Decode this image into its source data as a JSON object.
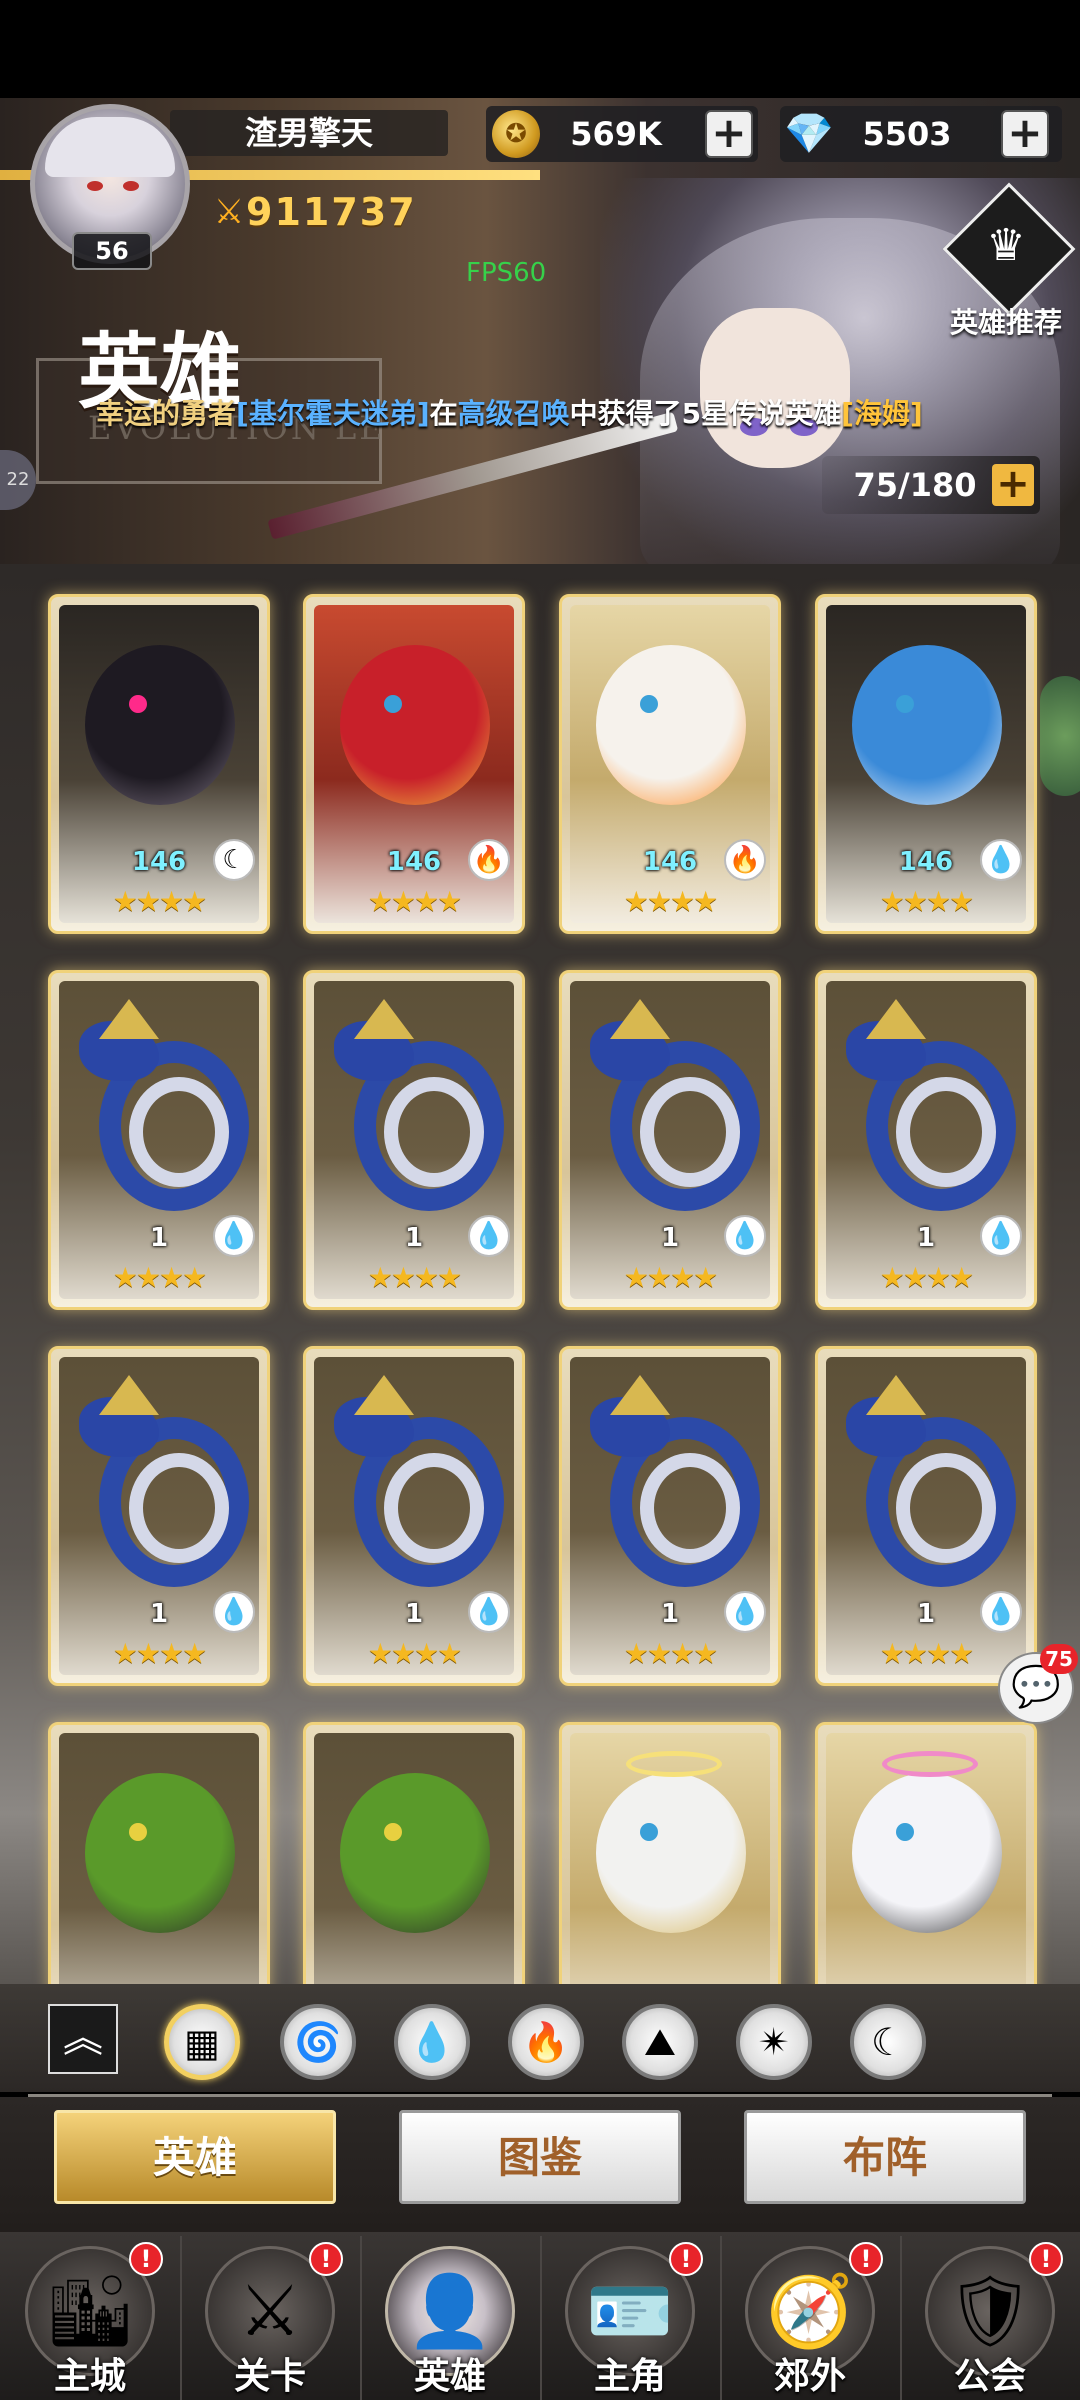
{
  "player": {
    "name": "渣男擎天",
    "level": "56",
    "power": "911737"
  },
  "currency": {
    "gold": "569K",
    "gems": "5503",
    "plus": "+"
  },
  "fps": "FPS60",
  "recommend_label": "英雄推荐",
  "page_title": "英雄",
  "title_watermark": "EVOLUTION LE",
  "side_bubble": "22",
  "marquee": {
    "part1": "幸运的勇者",
    "part2": "[基尔霍夫迷弟]",
    "part3": "在",
    "part4": "高级召唤",
    "part5": "中获得了5星传说英雄",
    "part6": "[海姆]"
  },
  "capacity": {
    "value": "75/180",
    "plus": "+"
  },
  "hero_cards": [
    {
      "level": "146",
      "element": "moon-icon",
      "stars": 4
    },
    {
      "level": "146",
      "element": "fire-icon",
      "stars": 4
    },
    {
      "level": "146",
      "element": "fire-icon",
      "stars": 4
    },
    {
      "level": "146",
      "element": "water-icon",
      "stars": 4
    },
    {
      "level": "1",
      "element": "water-icon",
      "stars": 4
    },
    {
      "level": "1",
      "element": "water-icon",
      "stars": 4
    },
    {
      "level": "1",
      "element": "water-icon",
      "stars": 4
    },
    {
      "level": "1",
      "element": "water-icon",
      "stars": 4
    },
    {
      "level": "1",
      "element": "water-icon",
      "stars": 4
    },
    {
      "level": "1",
      "element": "water-icon",
      "stars": 4
    },
    {
      "level": "1",
      "element": "water-icon",
      "stars": 4
    },
    {
      "level": "1",
      "element": "water-icon",
      "stars": 4
    },
    {
      "level": "",
      "element": "wind-icon",
      "stars": 0
    },
    {
      "level": "",
      "element": "wind-icon",
      "stars": 0
    },
    {
      "level": "",
      "element": "light-icon",
      "stars": 0
    },
    {
      "level": "",
      "element": "light-icon",
      "stars": 0
    }
  ],
  "filters": [
    {
      "name": "all-filter-icon",
      "glyph": "▦",
      "active": true
    },
    {
      "name": "wind-filter-icon",
      "glyph": "🌀",
      "active": false
    },
    {
      "name": "water-filter-icon",
      "glyph": "💧",
      "active": false
    },
    {
      "name": "fire-filter-icon",
      "glyph": "🔥",
      "active": false
    },
    {
      "name": "earth-filter-icon",
      "glyph": "⛰",
      "active": false
    },
    {
      "name": "light-filter-icon",
      "glyph": "✴",
      "active": false
    },
    {
      "name": "dark-filter-icon",
      "glyph": "☾",
      "active": false
    }
  ],
  "tabs": {
    "heroes": "英雄",
    "codex": "图鉴",
    "formation": "布阵"
  },
  "nav": [
    {
      "label": "主城",
      "icon": "city-icon",
      "badge": "!"
    },
    {
      "label": "关卡",
      "icon": "stage-icon",
      "badge": "!"
    },
    {
      "label": "英雄",
      "icon": "hero-icon",
      "badge": ""
    },
    {
      "label": "主角",
      "icon": "protagonist-icon",
      "badge": "!"
    },
    {
      "label": "郊外",
      "icon": "outskirts-icon",
      "badge": "!"
    },
    {
      "label": "公会",
      "icon": "guild-icon",
      "badge": "!"
    }
  ],
  "chat_badge": "75",
  "colors": {
    "gold_accent": "#f2d060",
    "badge_red": "#e8242a",
    "fps_green": "#36d14a"
  }
}
